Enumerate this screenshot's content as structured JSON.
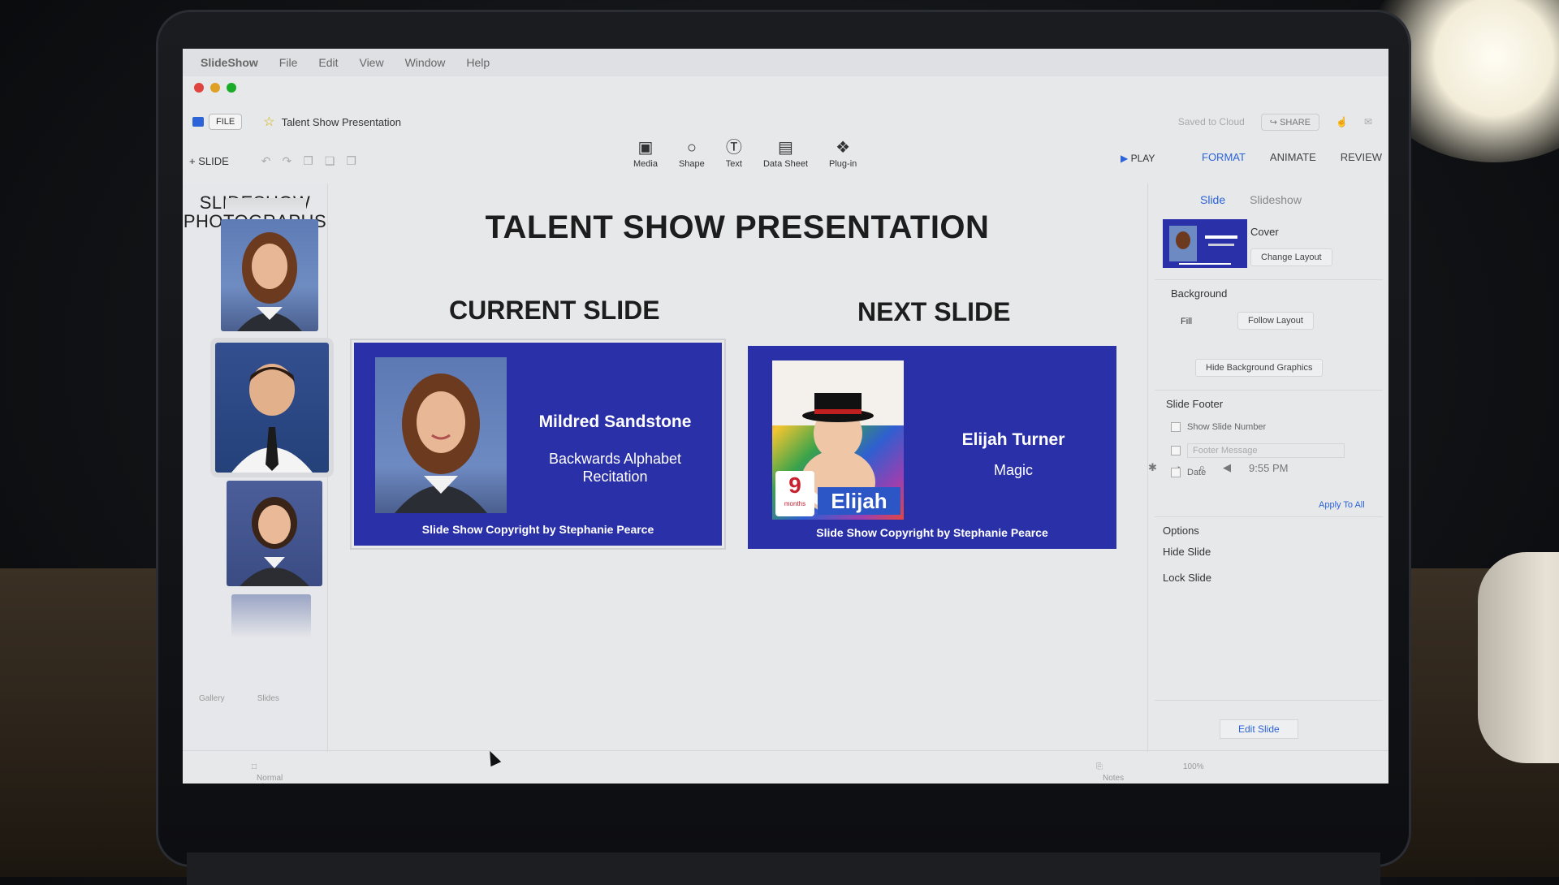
{
  "menubar": {
    "app": "SlideShow",
    "items": [
      "File",
      "Edit",
      "View",
      "Window",
      "Help"
    ],
    "clock": "9:55 PM"
  },
  "toprow": {
    "file_label": "FILE",
    "document_title": "Talent Show Presentation",
    "saved_status": "Saved to Cloud",
    "share_label": "SHARE"
  },
  "toolbar": {
    "add_slide": "+ SLIDE",
    "tools": [
      {
        "label": "Media",
        "icon": "media-icon"
      },
      {
        "label": "Shape",
        "icon": "shape-icon"
      },
      {
        "label": "Text",
        "icon": "text-icon"
      },
      {
        "label": "Data Sheet",
        "icon": "data-sheet-icon"
      },
      {
        "label": "Plug-in",
        "icon": "plugin-icon"
      }
    ],
    "play": "PLAY",
    "tabs": [
      "FORMAT",
      "ANIMATE",
      "REVIEW"
    ]
  },
  "sidebar": {
    "title": "SLIDESHOW PHOTOGRAPHS",
    "footer_tabs": [
      "Gallery",
      "Slides"
    ]
  },
  "main": {
    "title": "TALENT SHOW PRESENTATION",
    "current_heading": "CURRENT SLIDE",
    "next_heading": "NEXT SLIDE",
    "current_slide": {
      "name": "Mildred Sandstone",
      "act": "Backwards Alphabet Recitation",
      "copyright": "Slide Show Copyright by Stephanie Pearce"
    },
    "next_slide": {
      "name": "Elijah Turner",
      "act": "Magic",
      "copyright": "Slide Show Copyright by Stephanie Pearce",
      "photo_caption_number": "9",
      "photo_caption_unit": "months",
      "photo_caption_name": "Elijah"
    }
  },
  "panel": {
    "subtabs": [
      "Slide",
      "Slideshow"
    ],
    "layout_name": "Cover",
    "change_layout": "Change Layout",
    "background_heading": "Background",
    "fill_label": "Fill",
    "fill_value": "Follow Layout",
    "hide_bg": "Hide Background Graphics",
    "footer_heading": "Slide Footer",
    "show_slide_number": "Show Slide Number",
    "footer_message_placeholder": "Footer Message",
    "date_label": "Date",
    "apply_all": "Apply To All",
    "options_heading": "Options",
    "hide_slide": "Hide Slide",
    "lock_slide": "Lock Slide",
    "edit_slide": "Edit Slide"
  },
  "statusbar": {
    "view": "Normal View",
    "notes": "Notes",
    "zoom": "100%"
  },
  "colors": {
    "slide_bg": "#2a30a8",
    "accent": "#2c63d8"
  }
}
